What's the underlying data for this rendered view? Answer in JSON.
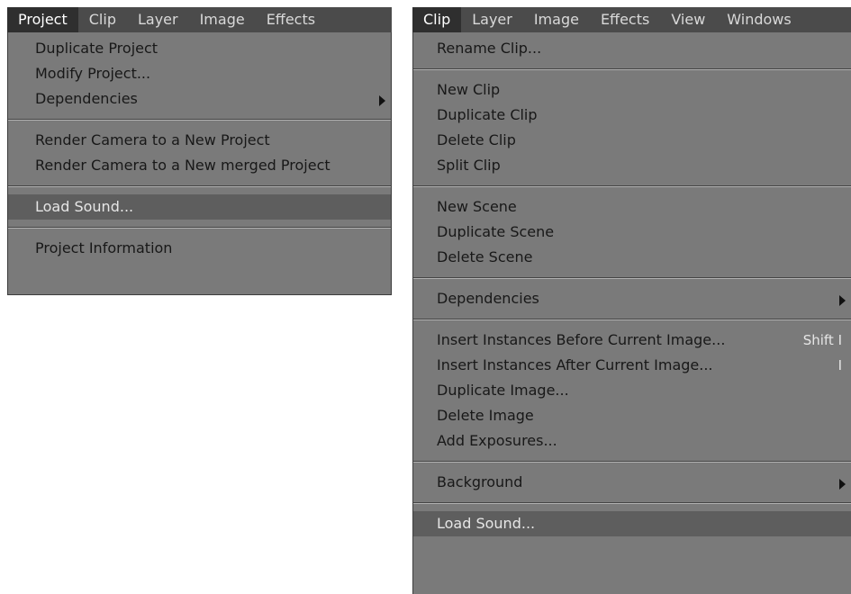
{
  "left": {
    "menubar": [
      "Project",
      "Clip",
      "Layer",
      "Image",
      "Effects"
    ],
    "active": "Project",
    "groups": [
      [
        {
          "label": "Duplicate Project"
        },
        {
          "label": "Modify Project..."
        },
        {
          "label": "Dependencies",
          "submenu": true
        }
      ],
      [
        {
          "label": "Render Camera to a New Project"
        },
        {
          "label": "Render Camera to a New merged Project"
        }
      ],
      [
        {
          "label": "Load Sound...",
          "highlight": true
        }
      ],
      [
        {
          "label": "Project Information"
        }
      ]
    ]
  },
  "right": {
    "menubar": [
      "Clip",
      "Layer",
      "Image",
      "Effects",
      "View",
      "Windows"
    ],
    "active": "Clip",
    "groups": [
      [
        {
          "label": "Rename Clip..."
        }
      ],
      [
        {
          "label": "New Clip"
        },
        {
          "label": "Duplicate Clip"
        },
        {
          "label": "Delete Clip"
        },
        {
          "label": "Split Clip"
        }
      ],
      [
        {
          "label": "New Scene"
        },
        {
          "label": "Duplicate Scene"
        },
        {
          "label": "Delete Scene"
        }
      ],
      [
        {
          "label": "Dependencies",
          "submenu": true
        }
      ],
      [
        {
          "label": "Insert Instances Before Current Image...",
          "shortcut": "Shift I"
        },
        {
          "label": "Insert Instances After Current Image...",
          "shortcut": "I"
        },
        {
          "label": "Duplicate Image..."
        },
        {
          "label": "Delete Image"
        },
        {
          "label": "Add Exposures..."
        }
      ],
      [
        {
          "label": "Background",
          "submenu": true
        }
      ],
      [
        {
          "label": "Load Sound...",
          "highlight": true
        }
      ]
    ]
  }
}
